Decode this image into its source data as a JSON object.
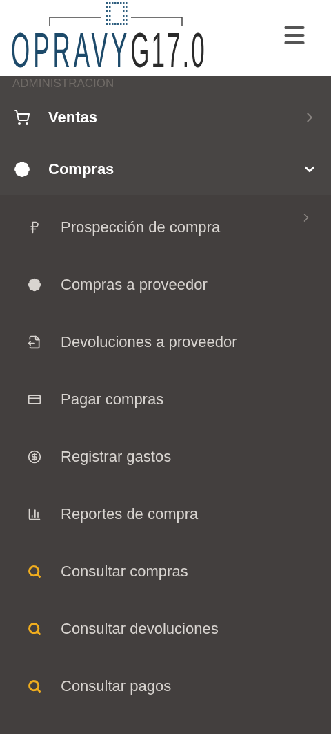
{
  "header": {
    "logo": {
      "primary": "OPRAVY",
      "secondary": "G17.0"
    }
  },
  "section_label": "ADMINISTRACION",
  "menu": [
    {
      "label": "Ventas",
      "expanded": false
    },
    {
      "label": "Compras",
      "expanded": true,
      "children": [
        {
          "label": "Prospección de compra",
          "kind": "submenu"
        },
        {
          "label": "Compras a proveedor",
          "kind": "link"
        },
        {
          "label": "Devoluciones a proveedor",
          "kind": "link"
        },
        {
          "label": "Pagar compras",
          "kind": "link"
        },
        {
          "label": "Registrar gastos",
          "kind": "link"
        },
        {
          "label": "Reportes de compra",
          "kind": "link"
        },
        {
          "label": "Consultar compras",
          "kind": "query"
        },
        {
          "label": "Consultar devoluciones",
          "kind": "query"
        },
        {
          "label": "Consultar pagos",
          "kind": "query"
        }
      ]
    }
  ]
}
